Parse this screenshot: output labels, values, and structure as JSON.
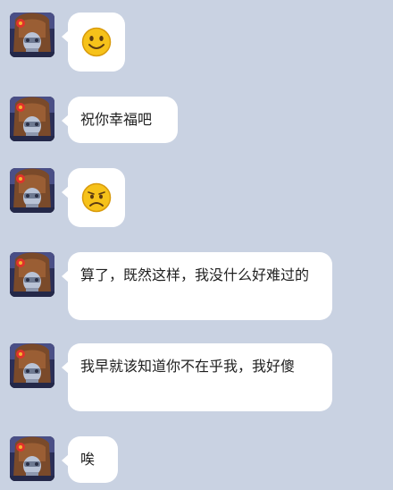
{
  "colors": {
    "background": "#c9d2e2",
    "bubble": "#ffffff",
    "text": "#1f1f1f",
    "emoji_yellow": "#f6c21a"
  },
  "messages": [
    {
      "type": "emoji",
      "icon": "smile-emoji"
    },
    {
      "type": "text",
      "text": "祝你幸福吧"
    },
    {
      "type": "emoji",
      "icon": "sad-emoji"
    },
    {
      "type": "text",
      "text": "算了，既然这样，我没什么好难过的"
    },
    {
      "type": "text",
      "text": "我早就该知道你不在乎我，我好傻"
    },
    {
      "type": "text",
      "text": "唉"
    }
  ]
}
